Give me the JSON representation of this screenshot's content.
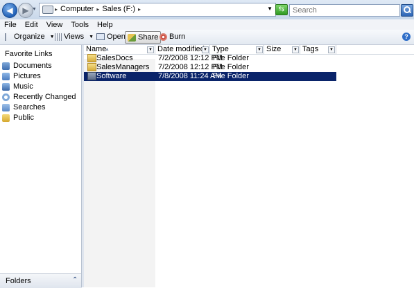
{
  "address": {
    "crumbs": [
      "Computer",
      "Sales (F:)"
    ]
  },
  "search": {
    "placeholder": "Search"
  },
  "menu": [
    "File",
    "Edit",
    "View",
    "Tools",
    "Help"
  ],
  "toolbar": {
    "organize": "Organize",
    "views": "Views",
    "open": "Open",
    "share": "Share",
    "burn": "Burn"
  },
  "nav": {
    "favorites_header": "Favorite Links",
    "items": [
      "Documents",
      "Pictures",
      "Music",
      "Recently Changed",
      "Searches",
      "Public"
    ],
    "folders_label": "Folders"
  },
  "columns": {
    "name": "Name",
    "date": "Date modified",
    "type": "Type",
    "size": "Size",
    "tags": "Tags"
  },
  "files": [
    {
      "name": "SalesDocs",
      "date": "7/2/2008 12:12 PM",
      "type": "File Folder",
      "selected": false
    },
    {
      "name": "SalesManagers",
      "date": "7/2/2008 12:12 PM",
      "type": "File Folder",
      "selected": false
    },
    {
      "name": "Software",
      "date": "7/8/2008 11:24 AM",
      "type": "File Folder",
      "selected": true
    }
  ],
  "colors": {
    "selection": "#0a246a",
    "folder": "#e8c862"
  }
}
